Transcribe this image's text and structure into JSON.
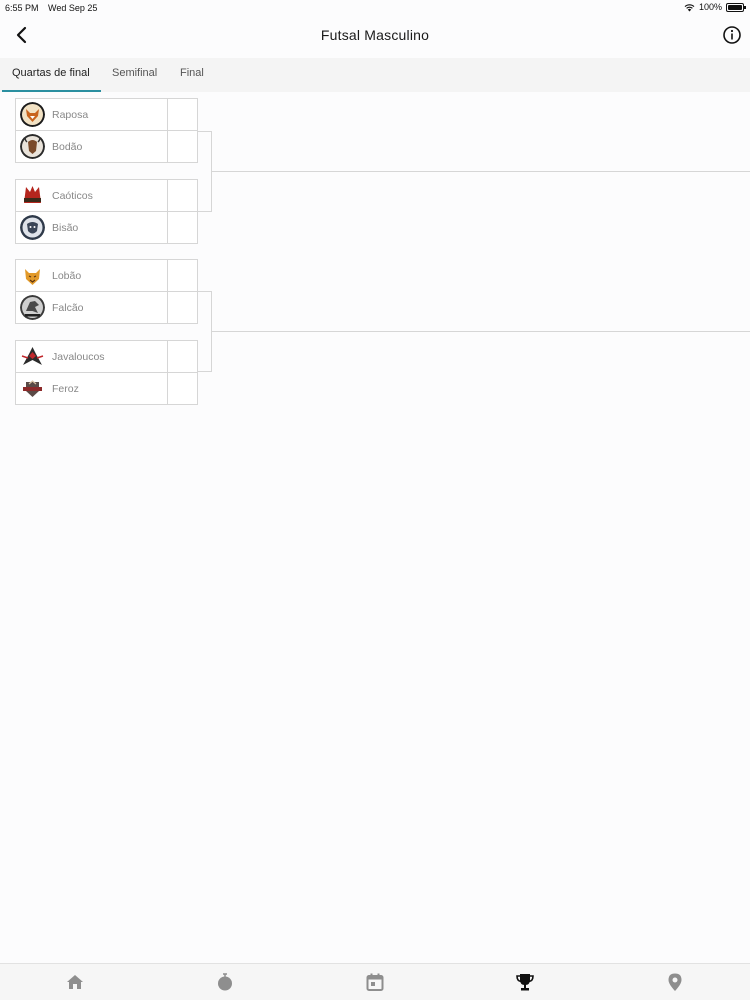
{
  "status": {
    "time": "6:55 PM",
    "date": "Wed Sep 25",
    "battery": "100%"
  },
  "nav": {
    "title": "Futsal Masculino",
    "back_icon": "chevron-left-icon",
    "info_icon": "info-circle-icon"
  },
  "tabs": [
    {
      "label": "Quartas de final",
      "active": true
    },
    {
      "label": "Semifinal",
      "active": false
    },
    {
      "label": "Final",
      "active": false
    }
  ],
  "matches": [
    {
      "teams": [
        {
          "name": "Raposa",
          "score": ""
        },
        {
          "name": "Bodão",
          "score": ""
        }
      ]
    },
    {
      "teams": [
        {
          "name": "Caóticos",
          "score": ""
        },
        {
          "name": "Bisão",
          "score": ""
        }
      ]
    },
    {
      "teams": [
        {
          "name": "Lobão",
          "score": ""
        },
        {
          "name": "Falcão",
          "score": ""
        }
      ]
    },
    {
      "teams": [
        {
          "name": "Javaloucos",
          "score": ""
        },
        {
          "name": "Feroz",
          "score": ""
        }
      ]
    }
  ],
  "bottom_tabs": [
    {
      "icon": "home-icon",
      "active": false
    },
    {
      "icon": "ball-icon",
      "active": false
    },
    {
      "icon": "calendar-icon",
      "active": false
    },
    {
      "icon": "trophy-icon",
      "active": true
    },
    {
      "icon": "location-pin-icon",
      "active": false
    }
  ],
  "colors": {
    "accent": "#2a8fa0",
    "border": "#d6d6d6",
    "team_text": "#888888",
    "icon_inactive": "#8e8e8e",
    "icon_active": "#111111"
  }
}
